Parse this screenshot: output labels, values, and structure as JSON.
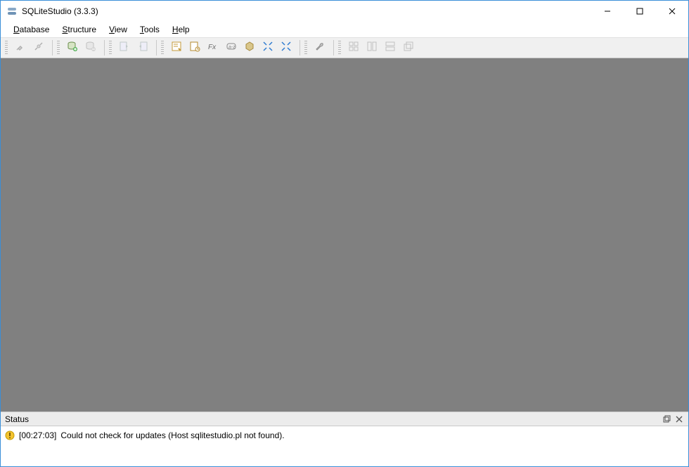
{
  "window": {
    "title": "SQLiteStudio (3.3.3)"
  },
  "menu": {
    "database": "Database",
    "structure": "Structure",
    "view": "View",
    "tools": "Tools",
    "help": "Help"
  },
  "toolbar": {
    "connect": "connect",
    "disconnect": "disconnect",
    "add_db": "add-database",
    "remove_db": "remove-database",
    "import": "import",
    "export": "export",
    "open_sql": "open-sql-editor",
    "sql_history": "sql-history",
    "functions": "functions-editor",
    "collations": "collations-editor",
    "extensions": "extensions-manager",
    "tile_h": "tile-horizontal",
    "tile_v": "tile-vertical",
    "config": "configuration",
    "win_tile": "window-tile",
    "win_cascade": "window-cascade",
    "win_rows": "window-rows",
    "win_cols": "window-cols"
  },
  "status": {
    "panel_title": "Status",
    "timestamp": "[00:27:03]",
    "message": "Could not check for updates (Host sqlitestudio.pl not found)."
  }
}
